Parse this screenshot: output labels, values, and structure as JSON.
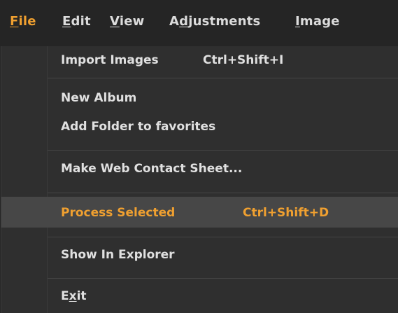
{
  "menubar": {
    "items": [
      {
        "mnemonic": "F",
        "rest": "ile"
      },
      {
        "mnemonic": "E",
        "rest": "dit"
      },
      {
        "mnemonic": "V",
        "rest": "iew"
      },
      {
        "pre": "A",
        "mnemonic": "d",
        "rest": "justments"
      },
      {
        "mnemonic": "I",
        "rest": "mage"
      }
    ]
  },
  "file_menu": {
    "import_images": {
      "label": "Import Images",
      "shortcut": "Ctrl+Shift+I"
    },
    "new_album": {
      "label": "New Album"
    },
    "add_folder": {
      "label": "Add Folder to favorites"
    },
    "make_web_contact_sheet": {
      "label": "Make Web Contact Sheet..."
    },
    "process_selected": {
      "label": "Process Selected",
      "shortcut": "Ctrl+Shift+D"
    },
    "show_in_explorer": {
      "label": "Show In Explorer"
    },
    "exit": {
      "pre": "E",
      "mnemonic": "x",
      "rest": "it"
    }
  },
  "colors": {
    "accent": "#f0a030",
    "text": "#e0e0e0",
    "menu_bg": "#2f2f2f",
    "highlight_bg": "#474747"
  }
}
